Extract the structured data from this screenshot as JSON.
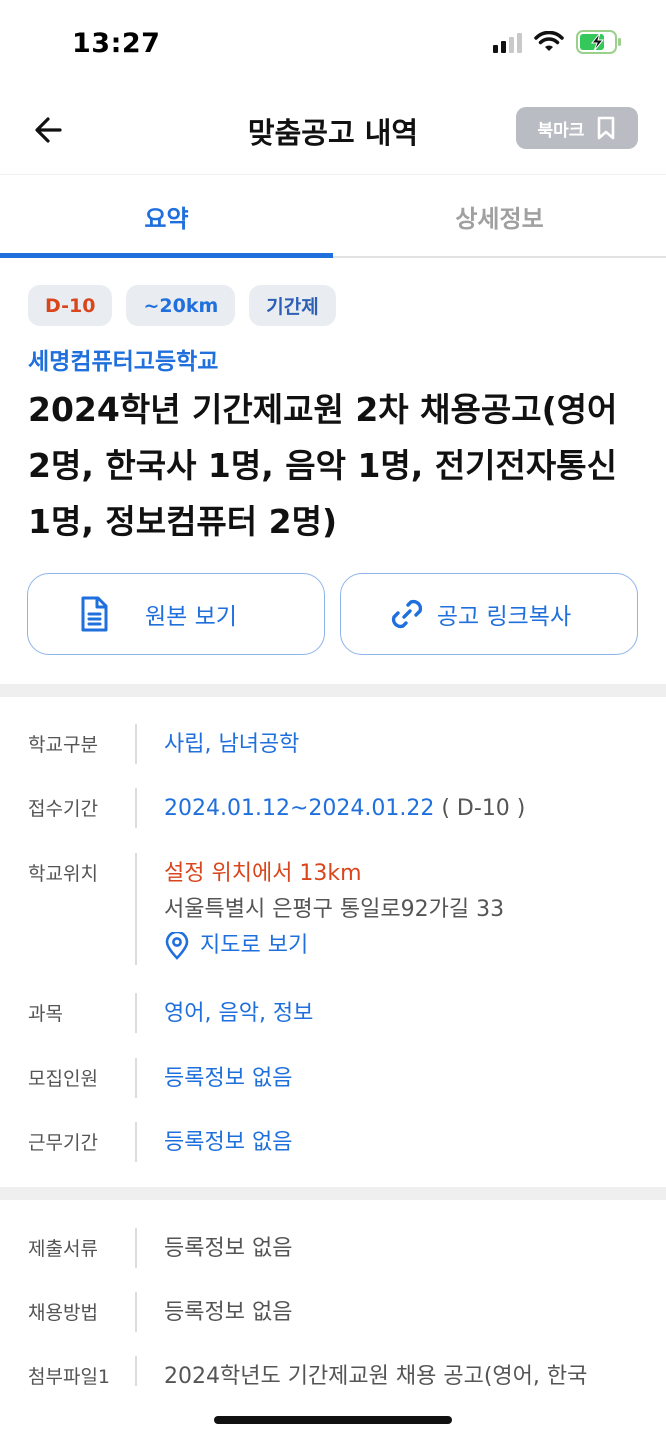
{
  "status_bar": {
    "time": "13:27"
  },
  "navbar": {
    "title": "맞춤공고 내역",
    "bookmark_label": "북마크"
  },
  "tabs": [
    {
      "label": "요약",
      "active": true
    },
    {
      "label": "상세정보",
      "active": false
    }
  ],
  "chips": {
    "dday": "D-10",
    "distance": "~20km",
    "type": "기간제"
  },
  "school_name": "세명컴퓨터고등학교",
  "post_title": "2024학년 기간제교원 2차 채용공고(영어 2명, 한국사 1명, 음악 1명, 전기전자통신 1명, 정보컴퓨터 2명)",
  "actions": {
    "view_original": "원본 보기",
    "copy_link": "공고 링크복사"
  },
  "info": {
    "school_type": {
      "label": "학교구분",
      "value": "사립, 남녀공학"
    },
    "period": {
      "label": "접수기간",
      "value": "2024.01.12~2024.01.22",
      "dday": "( D-10 )"
    },
    "location": {
      "label": "학교위치",
      "distance": "설정 위치에서 13km",
      "address": "서울특별시 은평구 통일로92가길 33",
      "map_link": "지도로 보기"
    },
    "subject": {
      "label": "과목",
      "value": "영어, 음악, 정보"
    },
    "recruits": {
      "label": "모집인원",
      "value": "등록정보 없음"
    },
    "work_period": {
      "label": "근무기간",
      "value": "등록정보 없음"
    }
  },
  "info2": {
    "documents": {
      "label": "제출서류",
      "value": "등록정보 없음"
    },
    "method": {
      "label": "채용방법",
      "value": "등록정보 없음"
    },
    "attachment": {
      "label": "첨부파일1",
      "value": "2024학년도 기간제교원 채용 공고(영어, 한국"
    }
  },
  "colors": {
    "accent": "#1f6fdc",
    "warning": "#d9461c",
    "muted": "#b9bcc2"
  }
}
